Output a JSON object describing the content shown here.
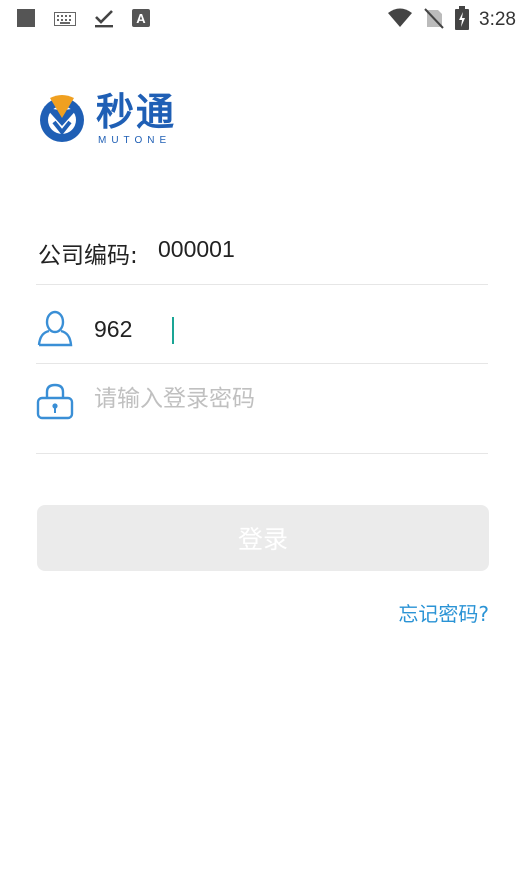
{
  "status_bar": {
    "time": "3:28",
    "left_icons": [
      "square-icon",
      "keyboard-icon",
      "download-done-icon",
      "a-icon"
    ],
    "right_icons": [
      "wifi-icon",
      "no-signal-icon",
      "battery-charging-icon"
    ]
  },
  "logo": {
    "name_cn": "秒通",
    "name_en": "MUTONE",
    "brand_color": "#1f5fb5",
    "accent_color": "#f0a020"
  },
  "form": {
    "company_label": "公司编码:",
    "company_code": "000001",
    "username_value": "962",
    "password_placeholder": "请输入登录密码"
  },
  "actions": {
    "login_label": "登录",
    "forgot_password": "忘记密码?"
  },
  "colors": {
    "link": "#2a93d5",
    "icon": "#3a8fd6",
    "button_bg": "#ebebeb",
    "caret": "#1aa595"
  }
}
